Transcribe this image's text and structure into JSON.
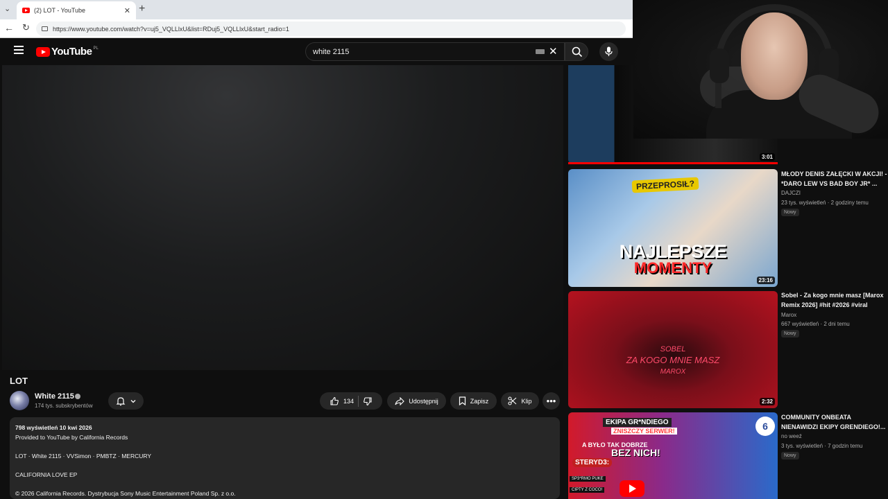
{
  "browser": {
    "tab_title": "(2) LOT - YouTube",
    "url": "https://www.youtube.com/watch?v=uj5_VQLLlxU&list=RDuj5_VQLLlxU&start_radio=1"
  },
  "youtube": {
    "logo_text": "YouTube",
    "country_code": "PL",
    "search_query": "white 2115"
  },
  "video": {
    "title": "LOT",
    "channel": "White 2115",
    "subscribers": "174 tys. subskrybentów",
    "likes": "134",
    "actions": {
      "share": "Udostępnij",
      "save": "Zapisz",
      "clip": "Klip"
    }
  },
  "description": {
    "meta": "798 wyświetleń  10 kwi 2026",
    "line1": "Provided to YouTube by California Records",
    "line2": "LOT · White 2115 · VVSimon · PMBTZ · MERCURY",
    "line3": "CALIFORNIA LOVE EP",
    "line4": "© 2026 California Records. Dystrybucja Sony Music Entertainment Poland Sp. z o.o."
  },
  "recommendations": [
    {
      "duration": "3:01",
      "progress_fraction": 1.0
    },
    {
      "title": "MŁODY DENIS ZAŁĘCKI W AKCJI! - *DARO LEW VS BAD BOY JR* ...",
      "channel": "DAJCZI",
      "stats": "23 tys. wyświetleń · 2 godziny temu",
      "badge": "Nowy",
      "duration": "23:16",
      "thumb_text_1": "PRZEPROSIŁ?",
      "thumb_text_2": "NAJLEPSZE",
      "thumb_text_3": "MOMENTY"
    },
    {
      "title": "Sobel - Za kogo mnie masz [Marox Remix 2026] #hit #2026 #viral",
      "channel": "Marox",
      "stats": "667 wyświetleń · 2 dni temu",
      "badge": "Nowy",
      "duration": "2:32",
      "thumb_text_1": "SOBEL",
      "thumb_text_2": "ZA KOGO MNIE MASZ",
      "thumb_text_3": "MAROX"
    },
    {
      "title": "COMMUNITY ONBEATA NIENAWIDZI EKIPY GRENDIEGO!...",
      "channel": "no weeź",
      "stats": "3 tys. wyświetleń · 7 godzin temu",
      "badge": "Nowy",
      "thumb_text_1": "EKIPA GR*NDIEGO",
      "thumb_text_2": "ZNISZCZY SERWER!",
      "thumb_text_3": "A BYŁO TAK DOBRZE",
      "thumb_text_4": "BEZ NICH!",
      "thumb_text_5": "STERYD3:",
      "thumb_text_6": "SP3*RMO PUKE",
      "thumb_text_7": "CIPTY Z COCO!",
      "thumb_text_8": "6"
    }
  ]
}
